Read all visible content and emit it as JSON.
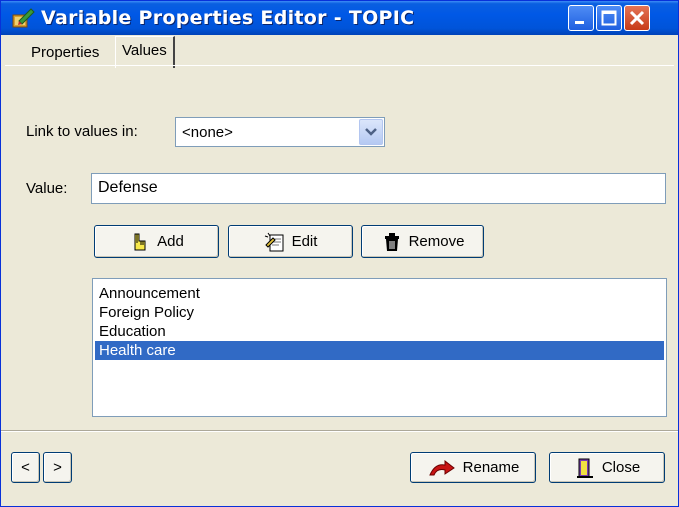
{
  "window": {
    "title": "Variable Properties Editor - TOPIC"
  },
  "tabs": [
    {
      "label": "Properties"
    },
    {
      "label": "Values",
      "active": true
    }
  ],
  "link": {
    "label": "Link to values in:",
    "selected": "<none>"
  },
  "value": {
    "label": "Value:",
    "current": "Defense"
  },
  "buttons": {
    "add": "Add",
    "edit": "Edit",
    "remove": "Remove",
    "rename": "Rename",
    "close": "Close"
  },
  "nav": {
    "prev": "<",
    "next": ">"
  },
  "list": {
    "items": [
      "Announcement",
      "Foreign Policy",
      "Education",
      "Health care"
    ],
    "selected_index": 3
  },
  "colors": {
    "titlebar": "#0058e6",
    "selection": "#316ac5",
    "face": "#ece9d8"
  }
}
